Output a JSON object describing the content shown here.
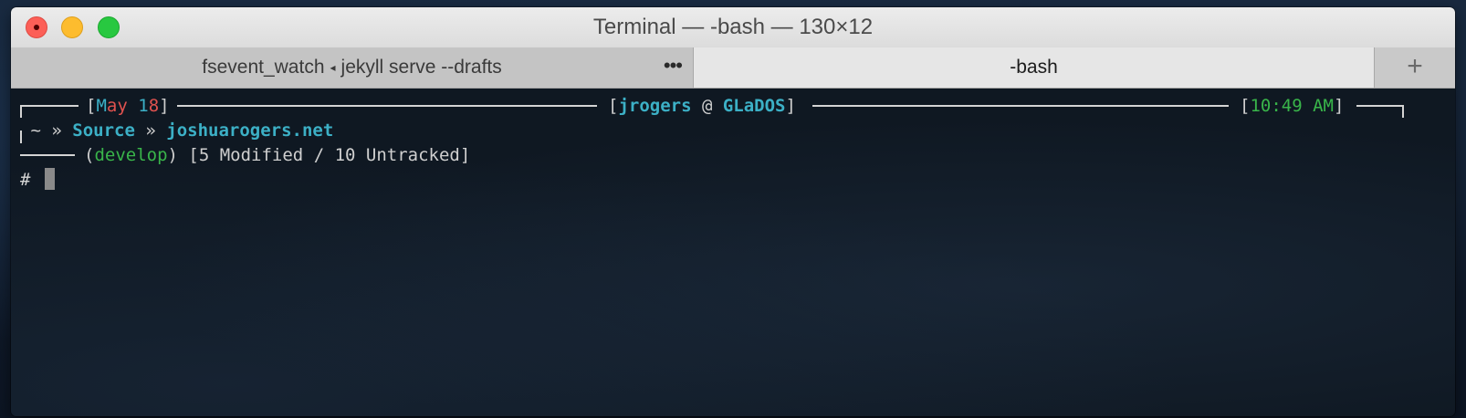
{
  "window": {
    "title": "Terminal — -bash — 130×12"
  },
  "tabs": [
    {
      "process": "fsevent_watch",
      "separator": "◂",
      "command": "jekyll serve --drafts",
      "more": "•••",
      "active": false
    },
    {
      "label": "-bash",
      "active": true
    }
  ],
  "new_tab_label": "+",
  "colors": {
    "accent_cyan": "#3cb0c6",
    "accent_red": "#e0524f",
    "accent_green": "#39b54a",
    "text": "#d4d4d4"
  },
  "prompt": {
    "date_month_a": "M",
    "date_month_b": "ay",
    "date_day_a": " 1",
    "date_day_b": "8",
    "user": "jrogers",
    "at": " @ ",
    "host": "GLaDOS",
    "time": "10:49 AM",
    "path_home": "~",
    "path_sep": "»",
    "path_dir": "Source",
    "path_repo": "joshuarogers.net",
    "branch": "develop",
    "status": "[5 Modified / 10 Untracked]",
    "input_prefix": "#"
  }
}
